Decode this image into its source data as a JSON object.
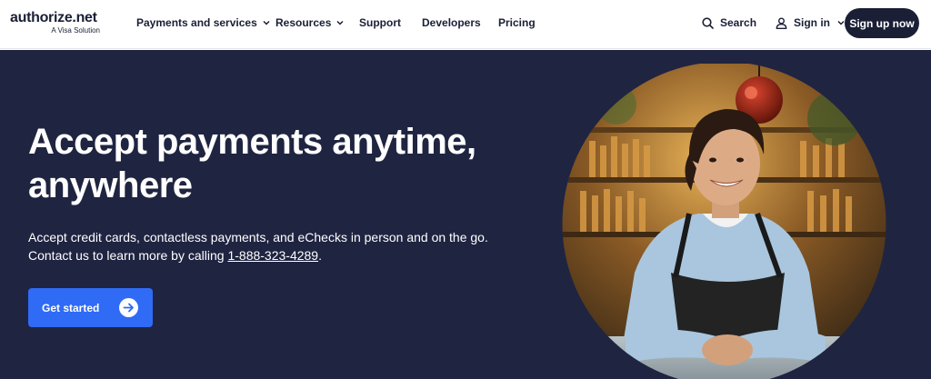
{
  "header": {
    "logo_text": "authorize.net",
    "logo_subtext": "A Visa Solution",
    "nav": [
      {
        "label": "Payments and services",
        "has_dropdown": true
      },
      {
        "label": "Resources",
        "has_dropdown": true
      },
      {
        "label": "Support",
        "has_dropdown": false
      },
      {
        "label": "Developers",
        "has_dropdown": false
      },
      {
        "label": "Pricing",
        "has_dropdown": false
      }
    ],
    "search_label": "Search",
    "signin_label": "Sign in",
    "signup_label": "Sign up now"
  },
  "hero": {
    "title": "Accept payments anytime, anywhere",
    "description_line1": "Accept credit cards, contactless payments, and eChecks in person and on the go.",
    "description_line2_prefix": "Contact us to learn more by calling ",
    "phone": "1-888-323-4289",
    "description_line2_suffix": ".",
    "cta_label": "Get started"
  },
  "colors": {
    "brand_dark": "#1a1f36",
    "hero_bg": "#1f2441",
    "cta_blue": "#2f6bf5",
    "white": "#ffffff"
  },
  "icons": [
    "search-icon",
    "user-icon",
    "chevron-down-icon",
    "arrow-right-icon"
  ]
}
